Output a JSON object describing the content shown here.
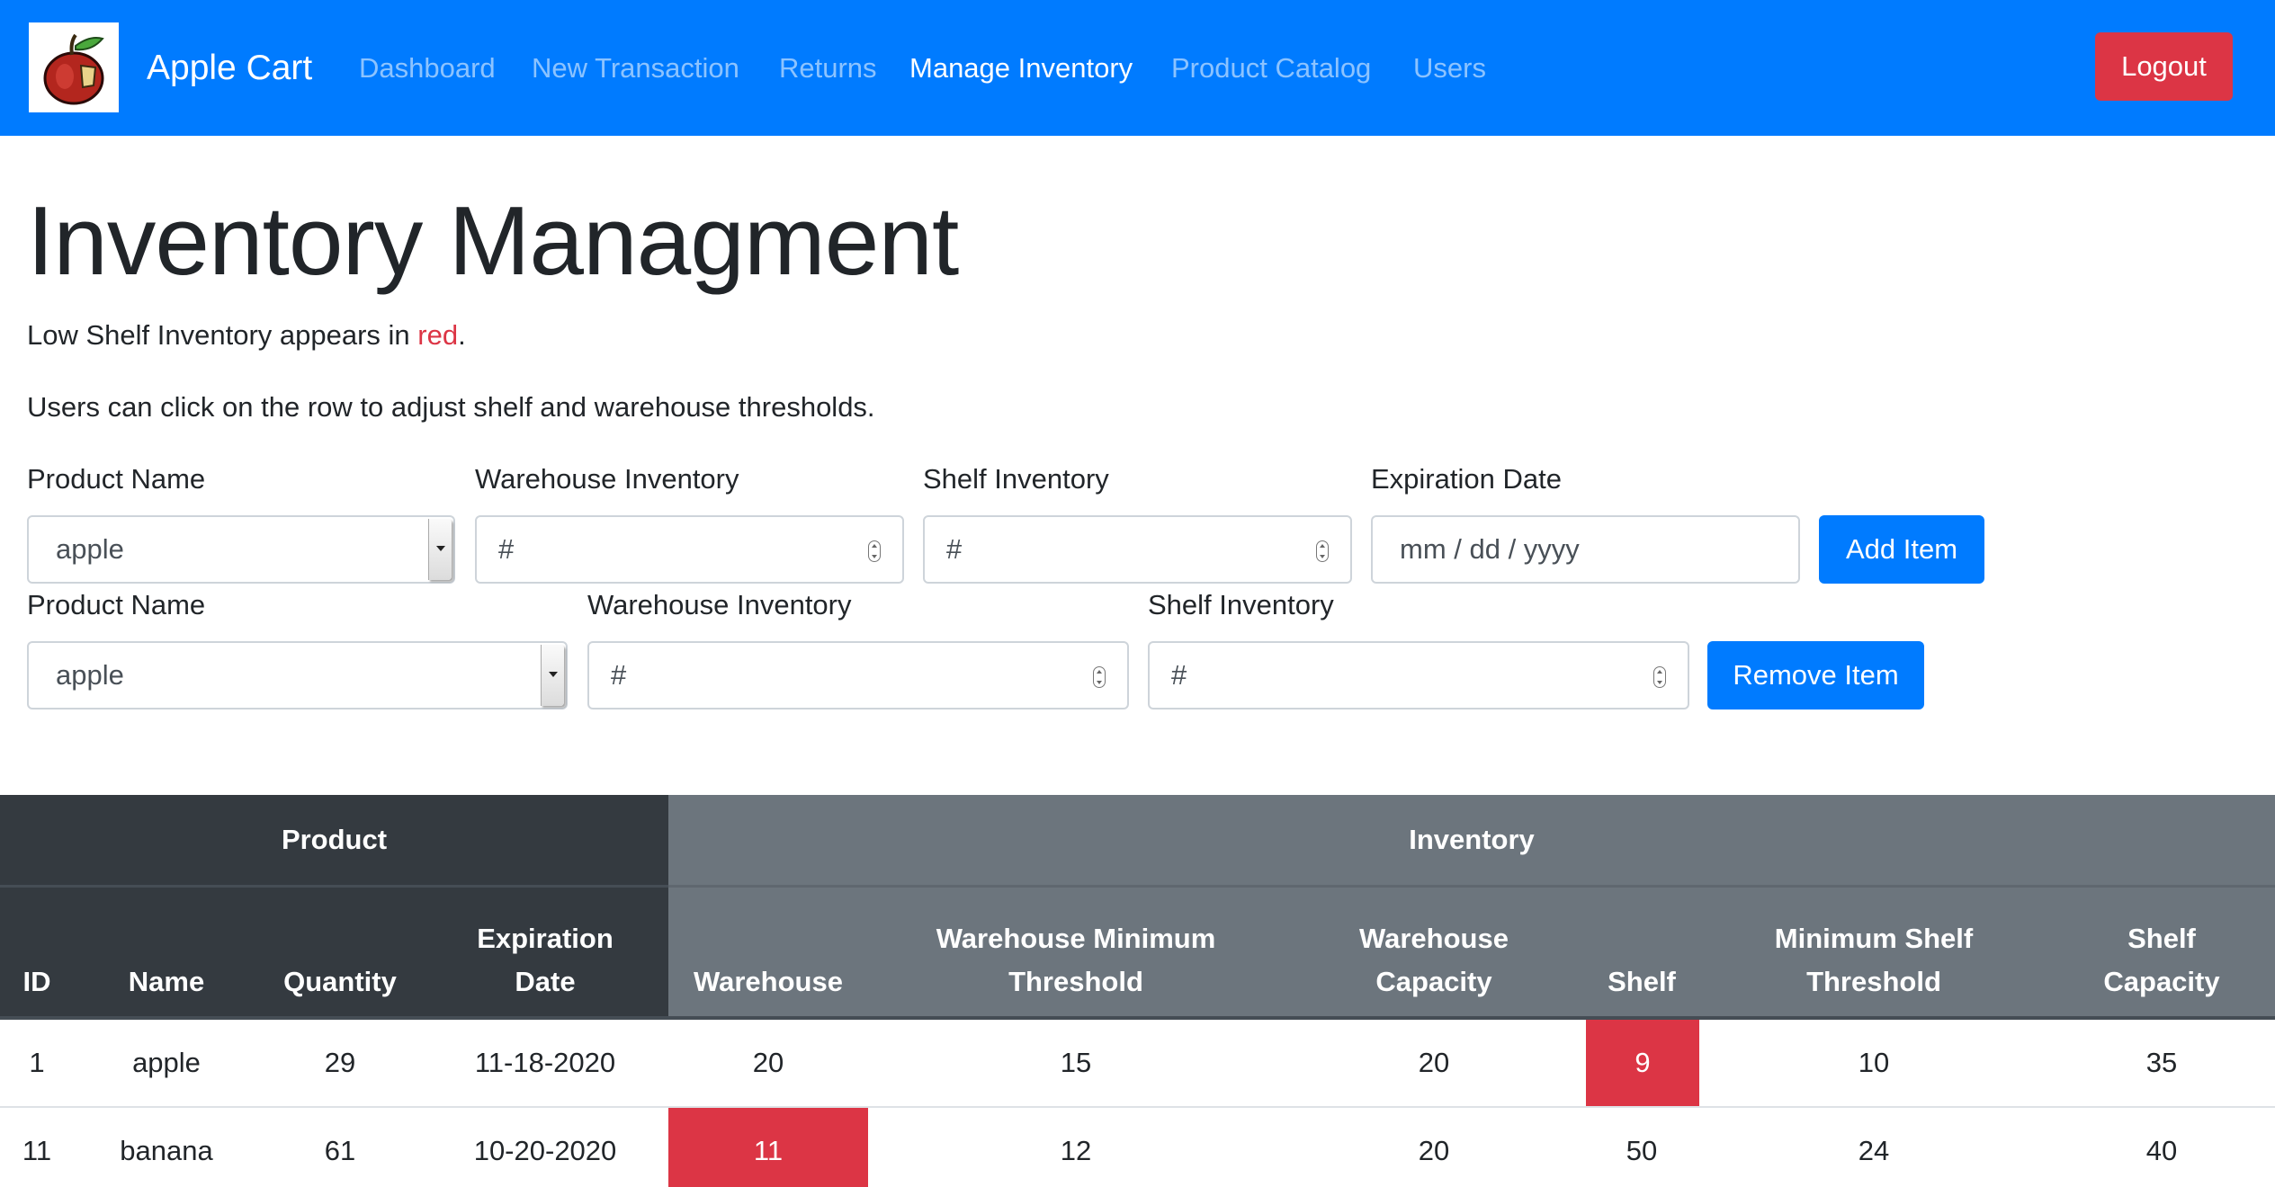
{
  "navbar": {
    "brand": "Apple Cart",
    "links": [
      "Dashboard",
      "New Transaction",
      "Returns",
      "Manage Inventory",
      "Product Catalog",
      "Users"
    ],
    "active": "Manage Inventory",
    "logout_label": "Logout"
  },
  "page": {
    "title": "Inventory Managment",
    "note_prefix": "Low Shelf Inventory appears in ",
    "note_red": "red",
    "note_suffix": ".",
    "instruction": "Users can click on the row to adjust shelf and warehouse thresholds."
  },
  "add_form": {
    "product_label": "Product Name",
    "product_value": "apple",
    "warehouse_label": "Warehouse Inventory",
    "warehouse_placeholder": "#",
    "shelf_label": "Shelf Inventory",
    "shelf_placeholder": "#",
    "expiration_label": "Expiration Date",
    "expiration_placeholder": "mm / dd / yyyy",
    "submit_label": "Add Item"
  },
  "remove_form": {
    "product_label": "Product Name",
    "product_value": "apple",
    "warehouse_label": "Warehouse Inventory",
    "warehouse_placeholder": "#",
    "shelf_label": "Shelf Inventory",
    "shelf_placeholder": "#",
    "submit_label": "Remove Item"
  },
  "table": {
    "group_product": "Product",
    "group_inventory": "Inventory",
    "columns": [
      [
        "ID"
      ],
      [
        "Name"
      ],
      [
        "Quantity"
      ],
      [
        "Expiration",
        "Date"
      ],
      [
        "Warehouse"
      ],
      [
        "Warehouse Minimum",
        "Threshold"
      ],
      [
        "Warehouse",
        "Capacity"
      ],
      [
        "Shelf"
      ],
      [
        "Minimum Shelf",
        "Threshold"
      ],
      [
        "Shelf",
        "Capacity"
      ]
    ],
    "rows": [
      {
        "id": "1",
        "name": "apple",
        "quantity": "29",
        "expiration": "11-18-2020",
        "warehouse": "20",
        "wh_min": "15",
        "wh_cap": "20",
        "shelf": "9",
        "shelf_min": "10",
        "shelf_cap": "35",
        "low": "shelf"
      },
      {
        "id": "11",
        "name": "banana",
        "quantity": "61",
        "expiration": "10-20-2020",
        "warehouse": "11",
        "wh_min": "12",
        "wh_cap": "20",
        "shelf": "50",
        "shelf_min": "24",
        "shelf_cap": "40",
        "low": "warehouse"
      }
    ]
  },
  "colors": {
    "primary": "#007bff",
    "danger": "#dc3545",
    "table_dark": "#343a40",
    "table_gray": "#6c757d"
  }
}
